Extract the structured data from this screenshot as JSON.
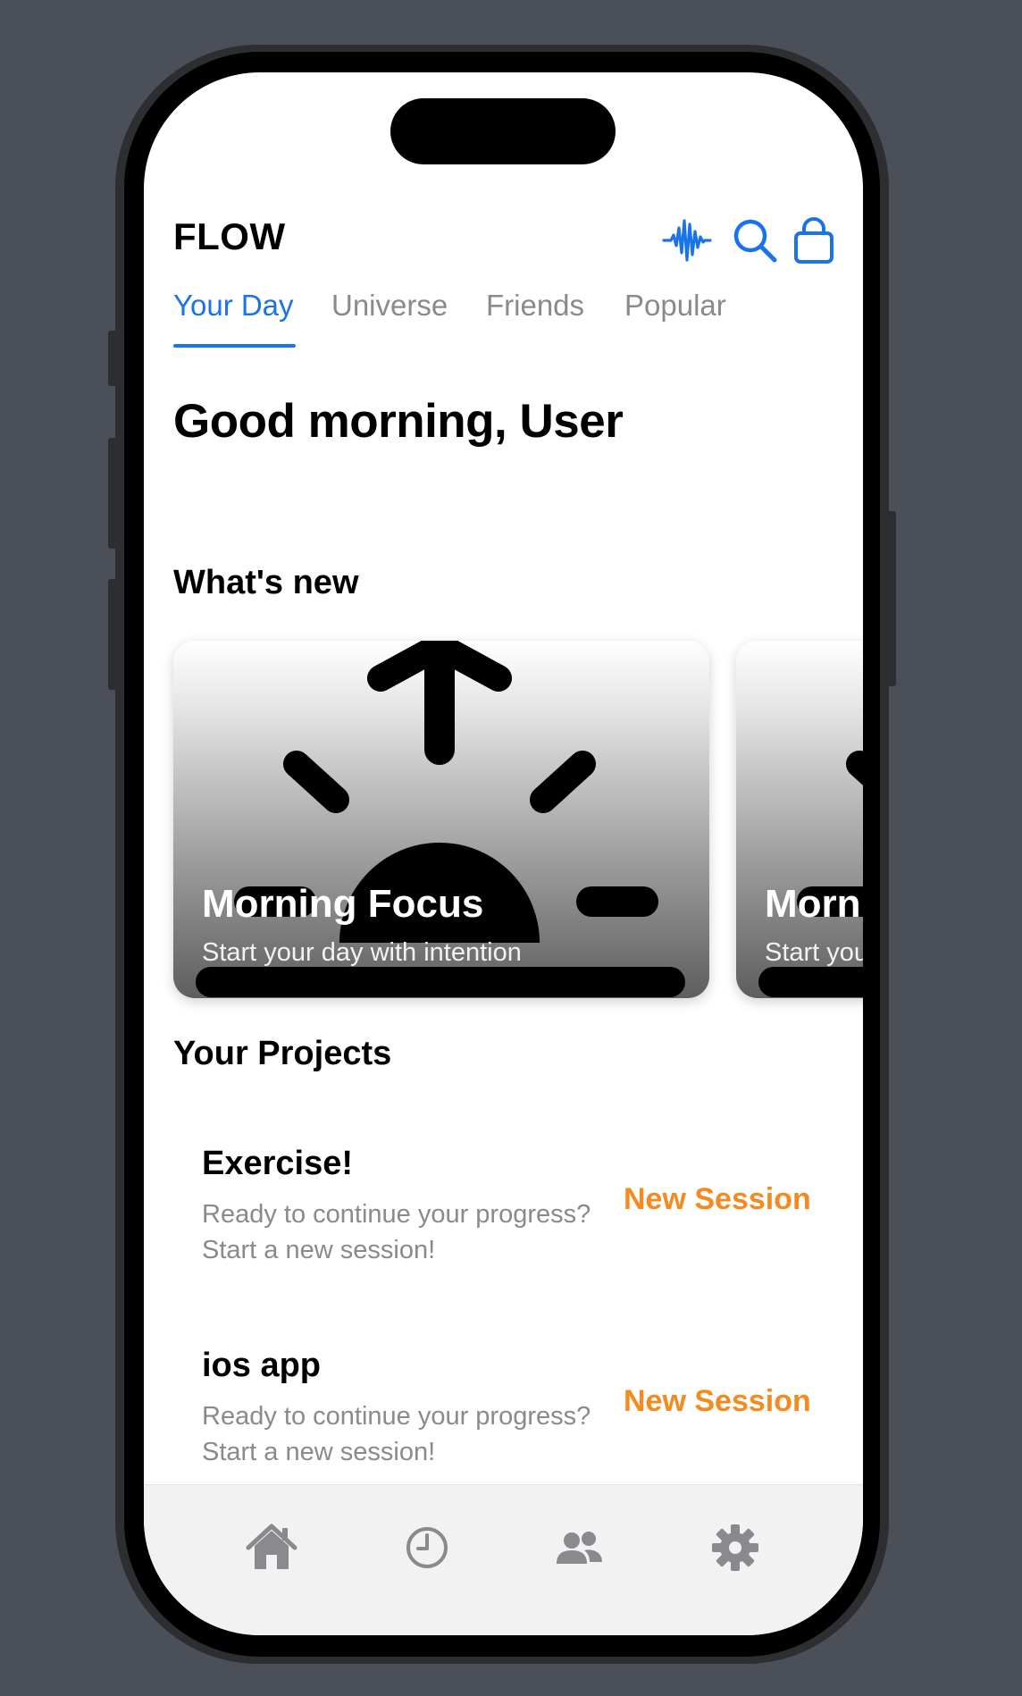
{
  "header": {
    "title": "FLOW",
    "icons": [
      "waveform-icon",
      "search-icon",
      "shopping-bag-icon"
    ],
    "accent_color": "#1a73e8"
  },
  "tabs": [
    {
      "label": "Your Day",
      "active": true
    },
    {
      "label": "Universe",
      "active": false
    },
    {
      "label": "Friends",
      "active": false
    },
    {
      "label": "Popular",
      "active": false
    }
  ],
  "greeting": "Good morning, User",
  "whats_new": {
    "title": "What's new",
    "cards": [
      {
        "title": "Morning Focus",
        "subtitle": "Start your day with intention",
        "icon": "sunrise-icon"
      },
      {
        "title": "Morning Focus",
        "subtitle": "Start your day with intention",
        "icon": "sunrise-icon"
      }
    ]
  },
  "projects": {
    "title": "Your Projects",
    "items": [
      {
        "name": "Exercise!",
        "description": "Ready to continue your progress? Start a new session!",
        "action": "New Session"
      },
      {
        "name": "ios app",
        "description": "Ready to continue your progress? Start a new session!",
        "action": "New Session"
      }
    ],
    "action_color": "#f68a1e"
  },
  "tab_bar": {
    "items": [
      "home-icon",
      "clock-icon",
      "people-icon",
      "gear-icon"
    ]
  }
}
